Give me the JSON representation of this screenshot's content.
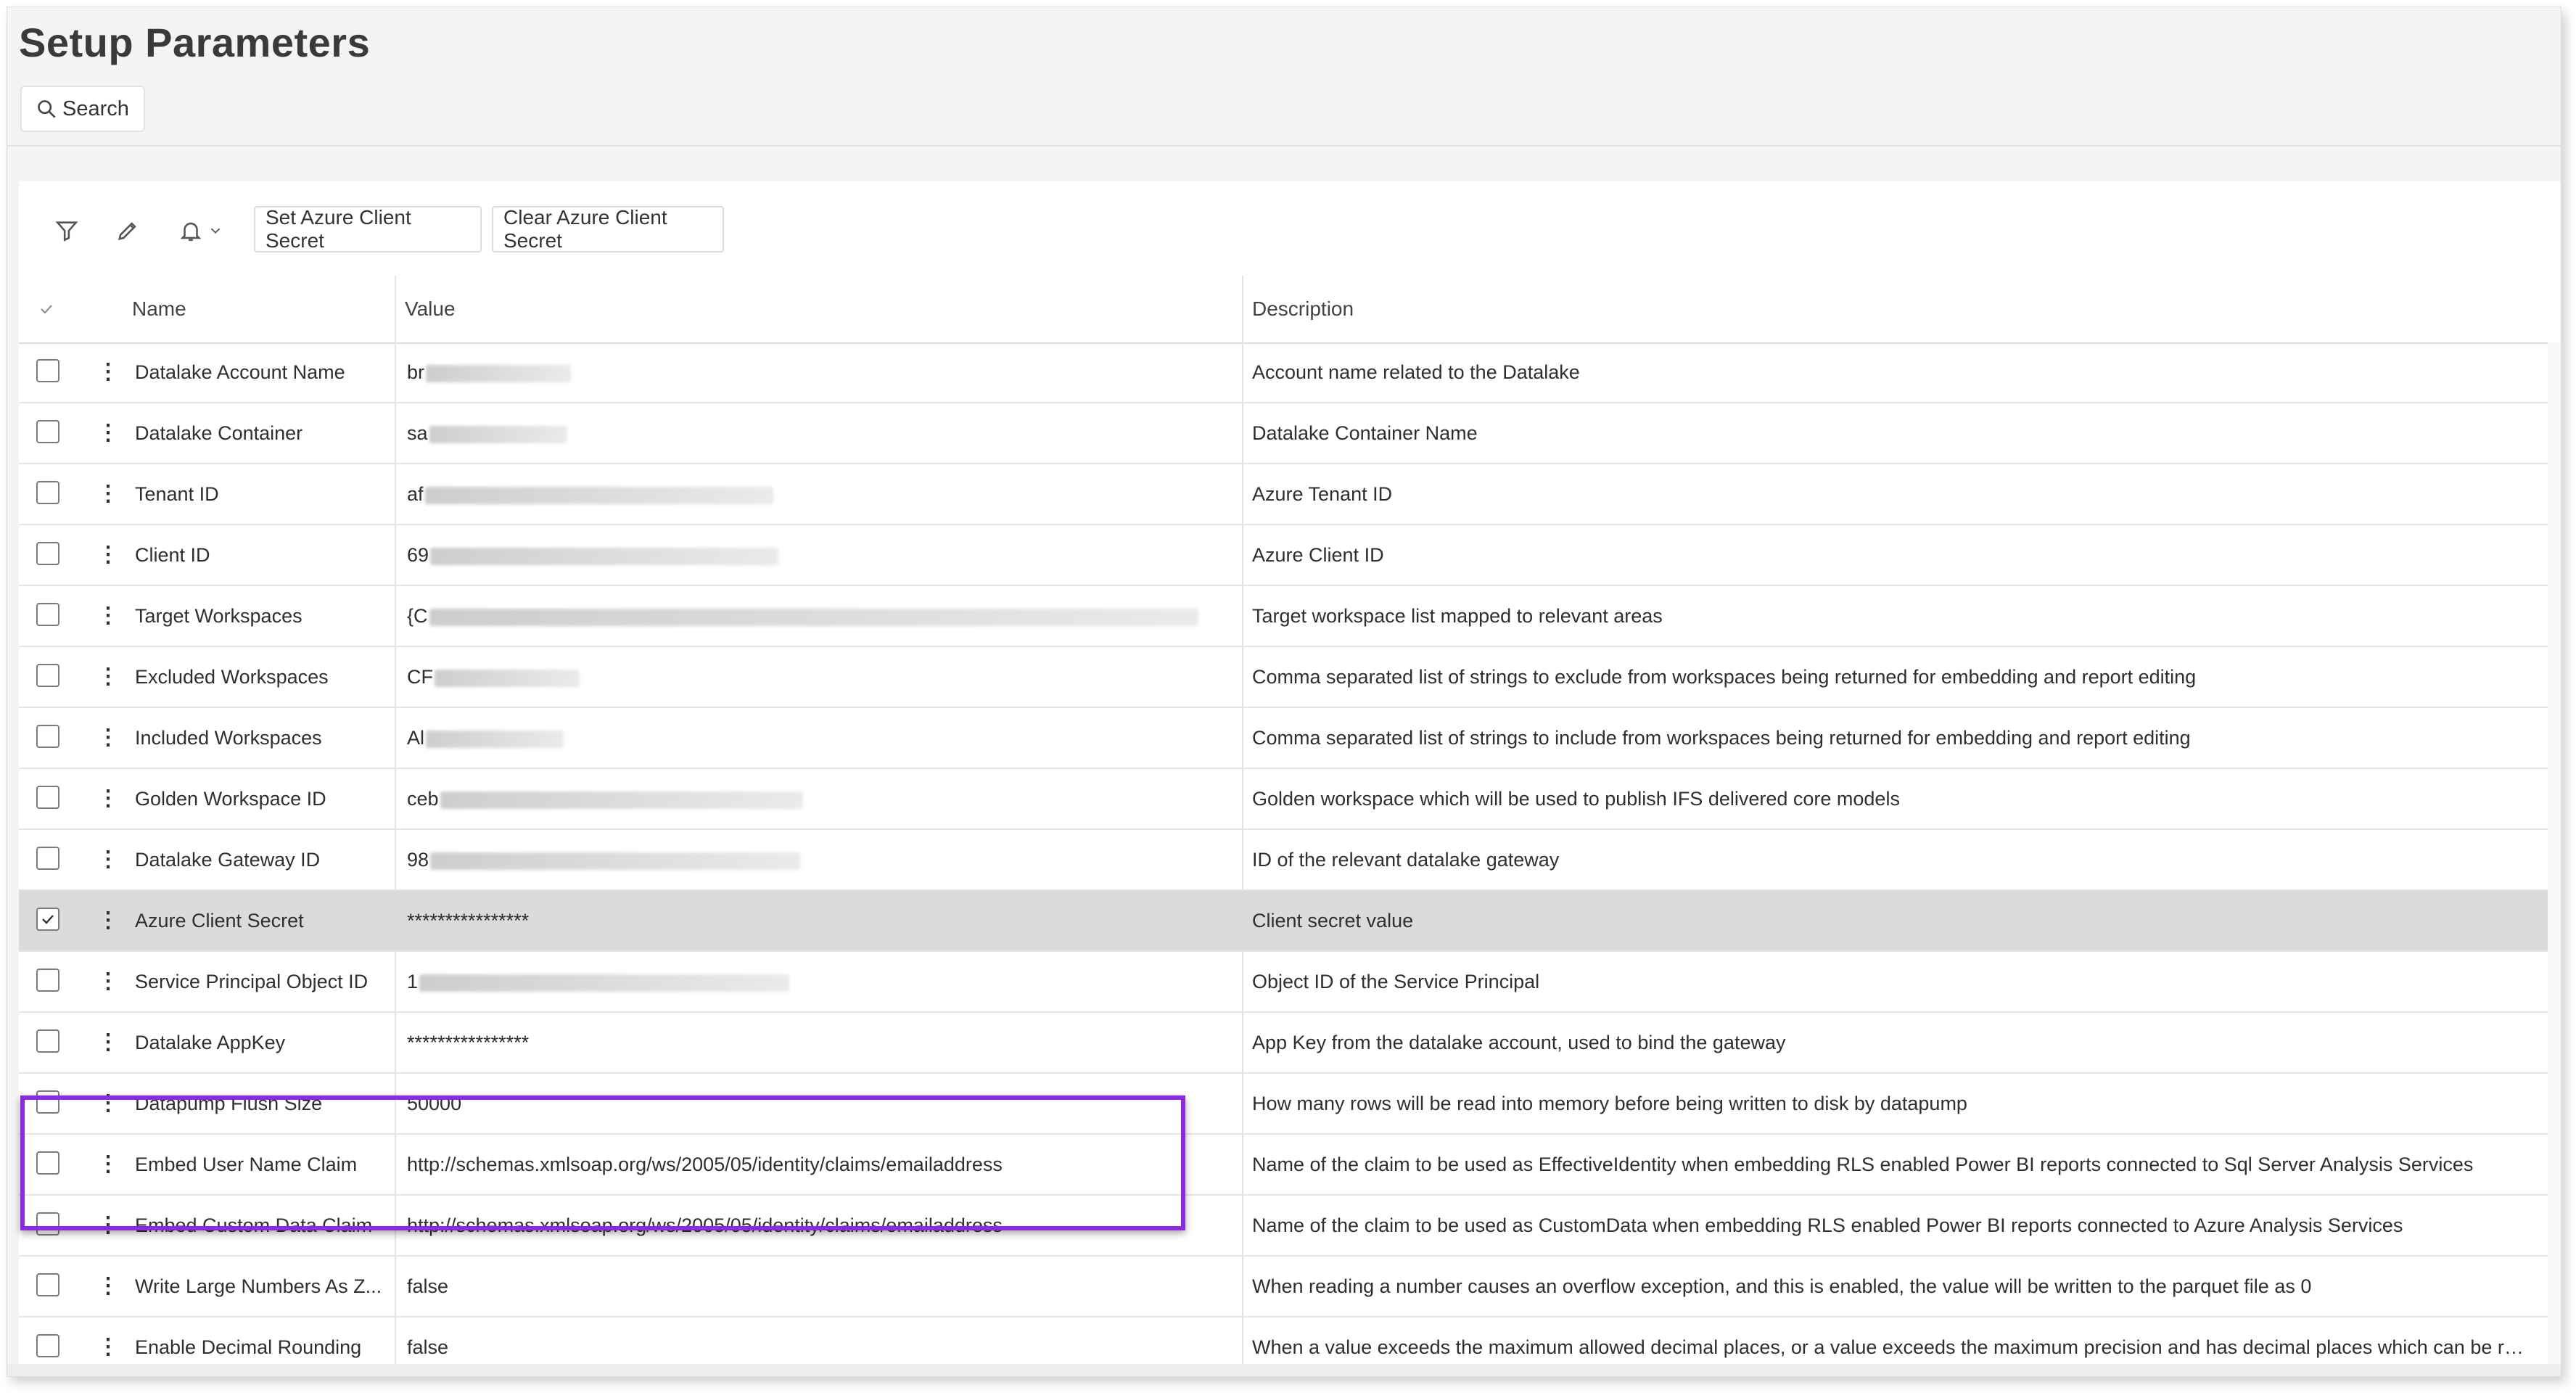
{
  "page": {
    "title": "Setup Parameters"
  },
  "search": {
    "label": "Search"
  },
  "toolbar": {
    "filter_icon": "filter-icon",
    "edit_icon": "pencil-icon",
    "bell_icon": "bell-icon",
    "set_secret_label": "Set Azure Client Secret",
    "clear_secret_label": "Clear Azure Client Secret"
  },
  "columns": {
    "name": "Name",
    "value": "Value",
    "description": "Description"
  },
  "rows": [
    {
      "name": "Datalake Account Name",
      "value": "br",
      "description": "Account name related to the Datalake"
    },
    {
      "name": "Datalake Container",
      "value": "sa",
      "description": "Datalake Container Name"
    },
    {
      "name": "Tenant ID",
      "value": "af",
      "description": "Azure Tenant ID"
    },
    {
      "name": "Client ID",
      "value": "69",
      "description": "Azure Client ID"
    },
    {
      "name": "Target Workspaces",
      "value": "{C",
      "description": "Target workspace list mapped to relevant areas"
    },
    {
      "name": "Excluded Workspaces",
      "value": "CF",
      "description": "Comma separated list of strings to exclude from workspaces being returned for embedding and report editing"
    },
    {
      "name": "Included Workspaces",
      "value": "Al",
      "description": "Comma separated list of strings to include from workspaces being returned for embedding and report editing"
    },
    {
      "name": "Golden Workspace ID",
      "value": "ceb",
      "description": "Golden workspace which will be used to publish IFS delivered core models"
    },
    {
      "name": "Datalake Gateway ID",
      "value": "98",
      "description": "ID of the relevant datalake gateway"
    },
    {
      "name": "Azure Client Secret",
      "value": "****************",
      "description": "Client secret value"
    },
    {
      "name": "Service Principal Object ID",
      "value": "1",
      "description": "Object ID of the Service Principal"
    },
    {
      "name": "Datalake AppKey",
      "value": "****************",
      "description": "App Key from the datalake account, used to bind the gateway"
    },
    {
      "name": "Datapump Flush Size",
      "value": "50000",
      "description": "How many rows will be read into memory before being written to disk by datapump"
    },
    {
      "name": "Embed User Name Claim",
      "value": "http://schemas.xmlsoap.org/ws/2005/05/identity/claims/emailaddress",
      "description": "Name of the claim to be used as EffectiveIdentity when embedding RLS enabled Power BI reports connected to Sql Server Analysis Services"
    },
    {
      "name": "Embed Custom Data Claim",
      "value": "http://schemas.xmlsoap.org/ws/2005/05/identity/claims/emailaddress",
      "description": "Name of the claim to be used as CustomData when embedding RLS enabled Power BI reports connected to Azure Analysis Services"
    },
    {
      "name": "Write Large Numbers As Z...",
      "value": "false",
      "description": "When reading a number causes an overflow exception, and this is enabled, the value will be written to the parquet file as 0"
    },
    {
      "name": "Enable Decimal Rounding",
      "value": "false",
      "description": "When a value exceeds the maximum allowed decimal places, or a value exceeds the maximum precision and has decimal places which can be round..."
    }
  ],
  "colors": {
    "accent_highlight": "#8a2be2",
    "selected_row": "#dbdbdb",
    "focus": "#2f5fa8"
  }
}
